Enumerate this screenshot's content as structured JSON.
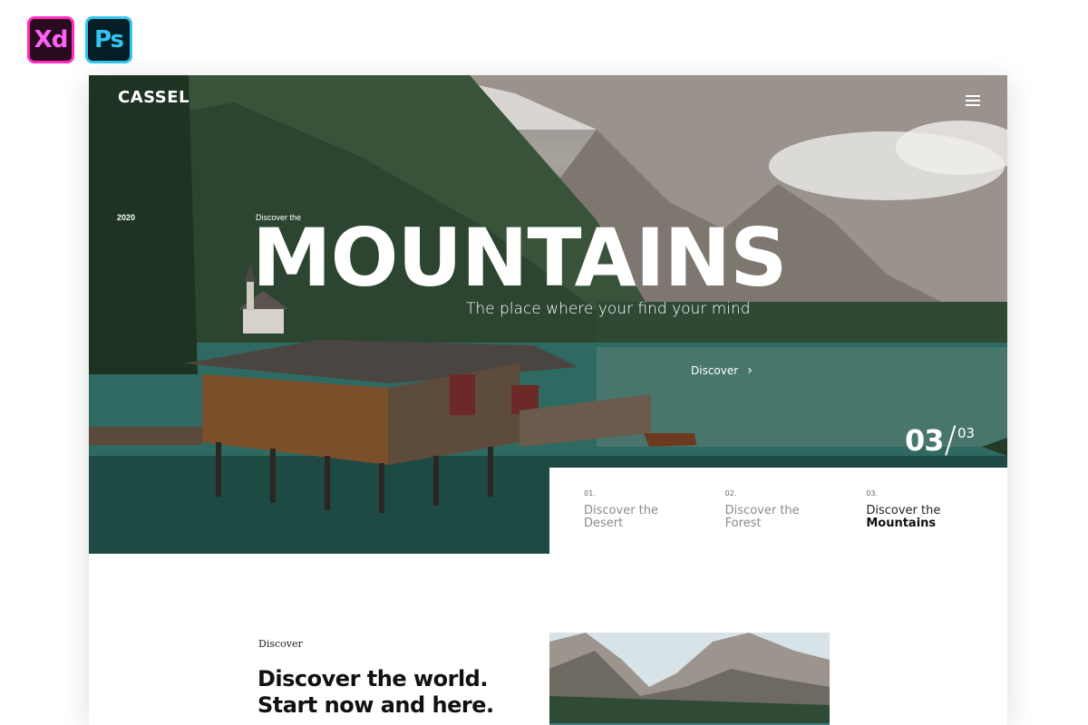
{
  "badges": {
    "xd": "Xd",
    "ps": "Ps"
  },
  "brand": {
    "logo": "CASSEL"
  },
  "header": {
    "menu_icon": "hamburger-menu-icon"
  },
  "hero": {
    "year": "2020",
    "kicker": "Discover the",
    "title": "MOUNTAINS",
    "subtitle": "The place where your find your mind",
    "cta_label": "Discover",
    "cta_icon": "chevron-right-icon",
    "counter_current": "03",
    "counter_total": "03"
  },
  "slides": [
    {
      "num": "01.",
      "line1": "Discover the",
      "line2": "Desert",
      "active": false
    },
    {
      "num": "02.",
      "line1": "Discover the",
      "line2": "Forest",
      "active": false
    },
    {
      "num": "03.",
      "line1": "Discover the",
      "line2": "Mountains",
      "active": true
    }
  ],
  "section": {
    "kicker": "Discover",
    "title_line1": "Discover the world.",
    "title_line2": "Start now and here."
  },
  "colors": {
    "xd_accent": "#ff61f6",
    "ps_accent": "#31c5f0",
    "text_dark": "#111111",
    "text_muted": "#8a8a8a"
  }
}
